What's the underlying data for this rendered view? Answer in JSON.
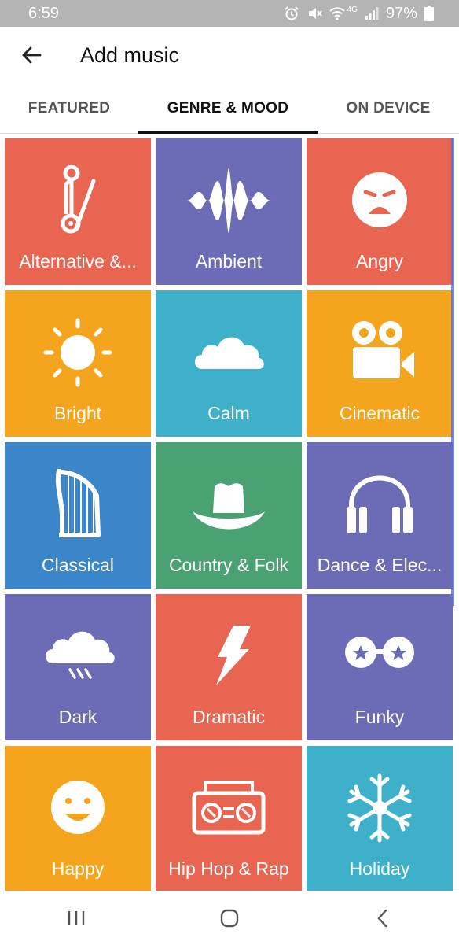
{
  "status_bar": {
    "time": "6:59",
    "network": "4G",
    "battery": "97%",
    "icons": [
      "alarm-icon",
      "mute-icon",
      "wifi-icon",
      "signal-icon",
      "battery-icon"
    ]
  },
  "app_bar": {
    "title": "Add music",
    "back_icon": "arrow-back-icon"
  },
  "tabs": [
    {
      "label": "FEATURED",
      "active": false
    },
    {
      "label": "GENRE & MOOD",
      "active": true
    },
    {
      "label": "ON DEVICE",
      "active": false
    }
  ],
  "tiles": [
    {
      "label": "Alternative &...",
      "icon": "safety-pin-icon",
      "color": "#e86552"
    },
    {
      "label": "Ambient",
      "icon": "sound-wave-icon",
      "color": "#6c6bb5"
    },
    {
      "label": "Angry",
      "icon": "angry-face-icon",
      "color": "#e86552"
    },
    {
      "label": "Bright",
      "icon": "sun-icon",
      "color": "#f5a51d"
    },
    {
      "label": "Calm",
      "icon": "cloud-icon",
      "color": "#3eb0c9"
    },
    {
      "label": "Cinematic",
      "icon": "movie-camera-icon",
      "color": "#f5a51d"
    },
    {
      "label": "Classical",
      "icon": "harp-icon",
      "color": "#3a86c8"
    },
    {
      "label": "Country & Folk",
      "icon": "cowboy-hat-icon",
      "color": "#4aa273"
    },
    {
      "label": "Dance & Elec...",
      "icon": "headphones-icon",
      "color": "#6c6bb5"
    },
    {
      "label": "Dark",
      "icon": "rain-cloud-icon",
      "color": "#6c6bb5"
    },
    {
      "label": "Dramatic",
      "icon": "lightning-icon",
      "color": "#e86552"
    },
    {
      "label": "Funky",
      "icon": "star-glasses-icon",
      "color": "#6c6bb5"
    },
    {
      "label": "Happy",
      "icon": "happy-face-icon",
      "color": "#f5a51d"
    },
    {
      "label": "Hip Hop & Rap",
      "icon": "boombox-icon",
      "color": "#e86552"
    },
    {
      "label": "Holiday",
      "icon": "snowflake-icon",
      "color": "#3eb0c9"
    }
  ],
  "nav_bar": {
    "icons": [
      "recent-apps-icon",
      "home-icon",
      "back-icon"
    ]
  }
}
